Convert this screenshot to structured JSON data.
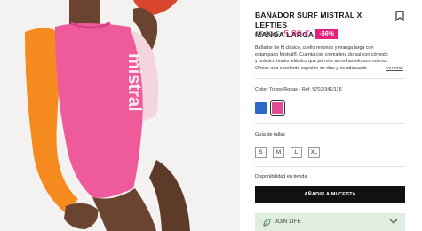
{
  "product": {
    "title_line1": "BAÑADOR SURF MISTRAL X LEFTIES",
    "title_line2": "MANGA LARGA",
    "old_price": "17,99 €",
    "new_price": "5,99 €",
    "discount": "-66%",
    "description_lines": [
      "Bañador de fit clásico, cuello redondo y manga larga con",
      "estampado Mistral®. Cuenta con cremallera dorsal con cómodo",
      "y práctico tirador elástico que permite abrocharselo uno mismo.",
      "Ofrece una excelente sujeción en olas y es adecuado"
    ],
    "see_more": "ver más",
    "color_line": "Color: Tonos Rosas - Ref. 5702/341/116",
    "size_guide": "Guía de tallas",
    "sizes": [
      "S",
      "M",
      "L",
      "XL"
    ],
    "availability": "Disponibilidad en tienda",
    "add_to_cart": "AÑADIR A MI CESTA",
    "join_life": "JOIN LIFE",
    "print_text": "mistral"
  },
  "colors": {
    "accent": "#e8217f",
    "swatch_blue": "#2f67c6",
    "swatch_pink": "#e34b96",
    "swimsuit_pink": "#ee5a9a",
    "sleeve_orange": "#f58a1f",
    "join_bg": "#dfeee0"
  },
  "icons": {
    "wishlist": "bookmark-icon",
    "join_life": "leaf-icon",
    "expand": "chevron-down-icon"
  }
}
